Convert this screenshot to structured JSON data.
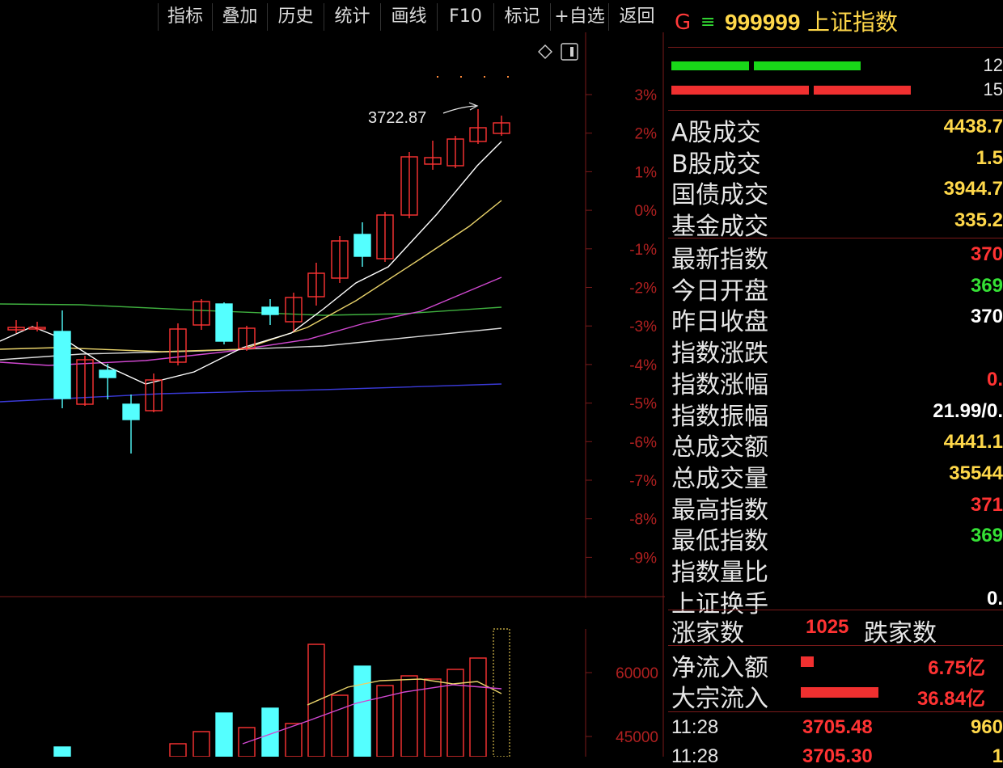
{
  "toolbar": {
    "buttons": [
      "指标",
      "叠加",
      "历史",
      "统计",
      "画线",
      "F10",
      "标记",
      "+自选",
      "返回"
    ]
  },
  "chart": {
    "annotation_high": "3722.87",
    "pct_ticks": [
      "3%",
      "2%",
      "1%",
      "0%",
      "-1%",
      "-2%",
      "-3%",
      "-4%",
      "-5%",
      "-6%",
      "-7%",
      "-8%",
      "-9%"
    ],
    "volume_ticks": [
      "60000",
      "45000"
    ],
    "colors": {
      "up": "#ff3333",
      "down": "#54ffff",
      "ma5": "#ffffff",
      "ma10": "#e8d26a",
      "ma20": "#d048d0",
      "ma30": "#3fb03f",
      "ma60": "#d8d8d8",
      "ma120": "#3a3ad8"
    }
  },
  "panel": {
    "title_g": "G",
    "title_icon": "menu-icon",
    "code": "999999",
    "name": "上证指数",
    "bar_counts": [
      "12",
      "15"
    ],
    "trade_rows": [
      {
        "label": "A股成交",
        "value": "4438.7",
        "color": "#ffd84a"
      },
      {
        "label": "B股成交",
        "value": "1.5",
        "color": "#ffd84a"
      },
      {
        "label": "国债成交",
        "value": "3944.7",
        "color": "#ffd84a"
      },
      {
        "label": "基金成交",
        "value": "335.2",
        "color": "#ffd84a"
      }
    ],
    "index_rows": [
      {
        "label": "最新指数",
        "value": "370",
        "color": "#ff3333"
      },
      {
        "label": "今日开盘",
        "value": "369",
        "color": "#35e035"
      },
      {
        "label": "昨日收盘",
        "value": "370",
        "color": "#ffffff"
      },
      {
        "label": "指数涨跌",
        "value": "",
        "color": "#ff3333"
      },
      {
        "label": "指数涨幅",
        "value": "0.",
        "color": "#ff3333"
      },
      {
        "label": "指数振幅",
        "value": "21.99/0.",
        "color": "#ffffff"
      },
      {
        "label": "总成交额",
        "value": "4441.1",
        "color": "#ffd84a"
      },
      {
        "label": "总成交量",
        "value": "35544",
        "color": "#ffd84a"
      },
      {
        "label": "最高指数",
        "value": "371",
        "color": "#ff3333"
      },
      {
        "label": "最低指数",
        "value": "369",
        "color": "#35e035"
      },
      {
        "label": "指数量比",
        "value": "",
        "color": "#ffffff"
      },
      {
        "label": "上证换手",
        "value": "0.",
        "color": "#ffffff"
      }
    ],
    "breadth": {
      "up_label": "涨家数",
      "up_value": "1025",
      "down_label": "跌家数"
    },
    "flows": [
      {
        "label": "净流入额",
        "value": "6.75亿"
      },
      {
        "label": "大宗流入",
        "value": "36.84亿"
      }
    ],
    "ticks": [
      {
        "time": "11:28",
        "price": "3705.48",
        "vol": "960"
      },
      {
        "time": "11:28",
        "price": "3705.30",
        "vol": "1"
      }
    ]
  }
}
